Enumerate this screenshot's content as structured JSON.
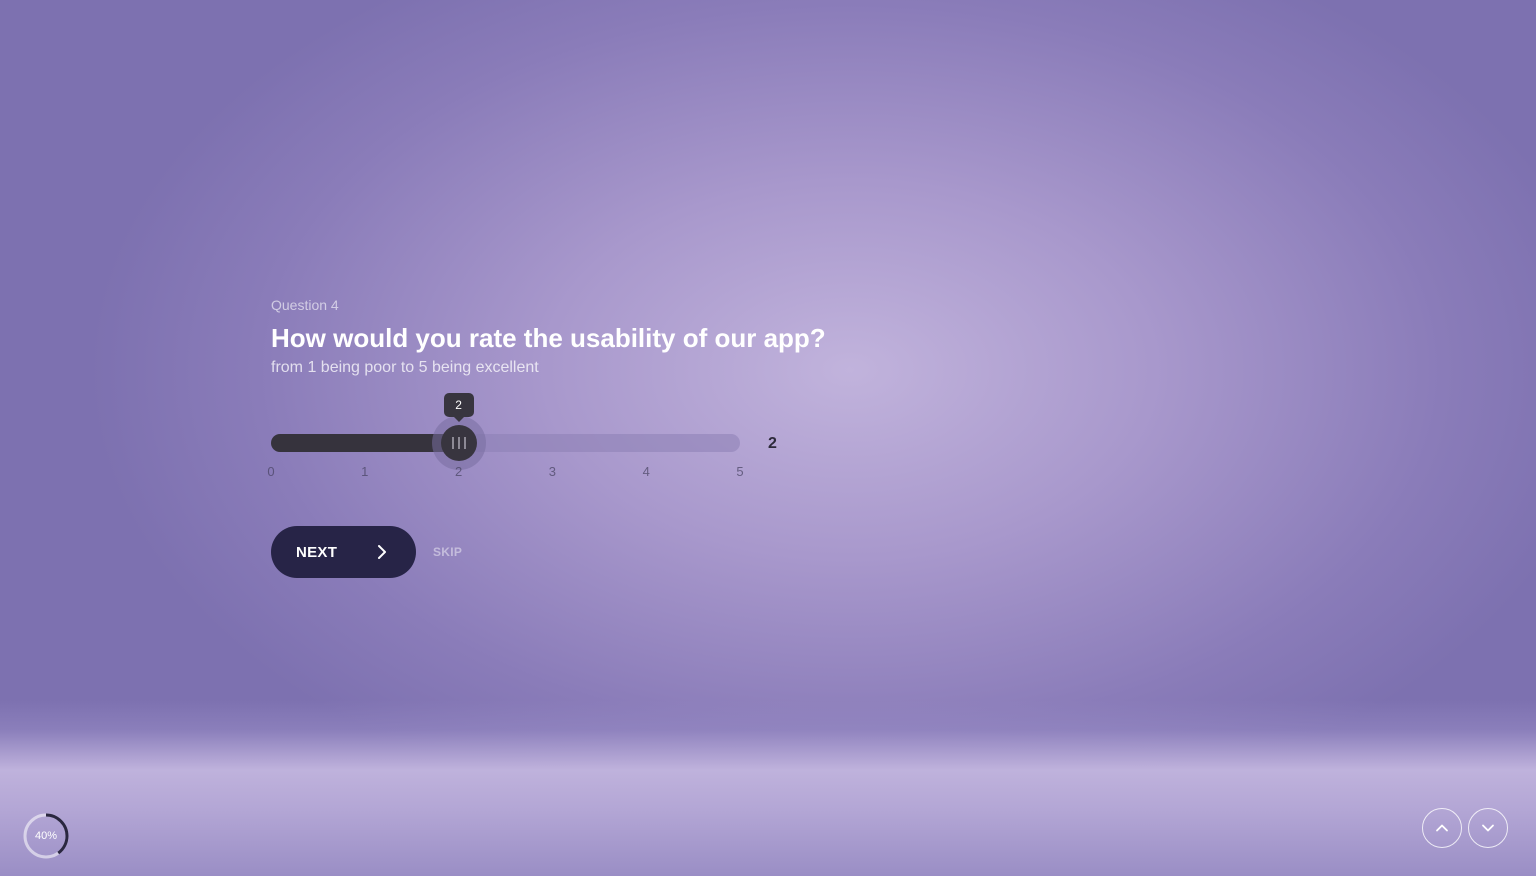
{
  "question": {
    "number_label": "Question 4",
    "title": "How would you rate the usability of our app?",
    "subtitle": "from 1 being poor to 5 being excellent"
  },
  "slider": {
    "min": 0,
    "max": 5,
    "value": 2,
    "tooltip": "2",
    "value_display": "2",
    "ticks": [
      "0",
      "1",
      "2",
      "3",
      "4",
      "5"
    ]
  },
  "actions": {
    "next_label": "NEXT",
    "skip_label": "SKIP"
  },
  "progress": {
    "percent": 40,
    "label": "40%"
  },
  "icons": {
    "next": "chevron-right-icon",
    "nav_up": "chevron-up-icon",
    "nav_down": "chevron-down-icon",
    "thumb": "grip-lines-icon"
  },
  "colors": {
    "button_bg": "#272447",
    "slider_fill": "#36333d",
    "accent_text": "#ffffff"
  }
}
